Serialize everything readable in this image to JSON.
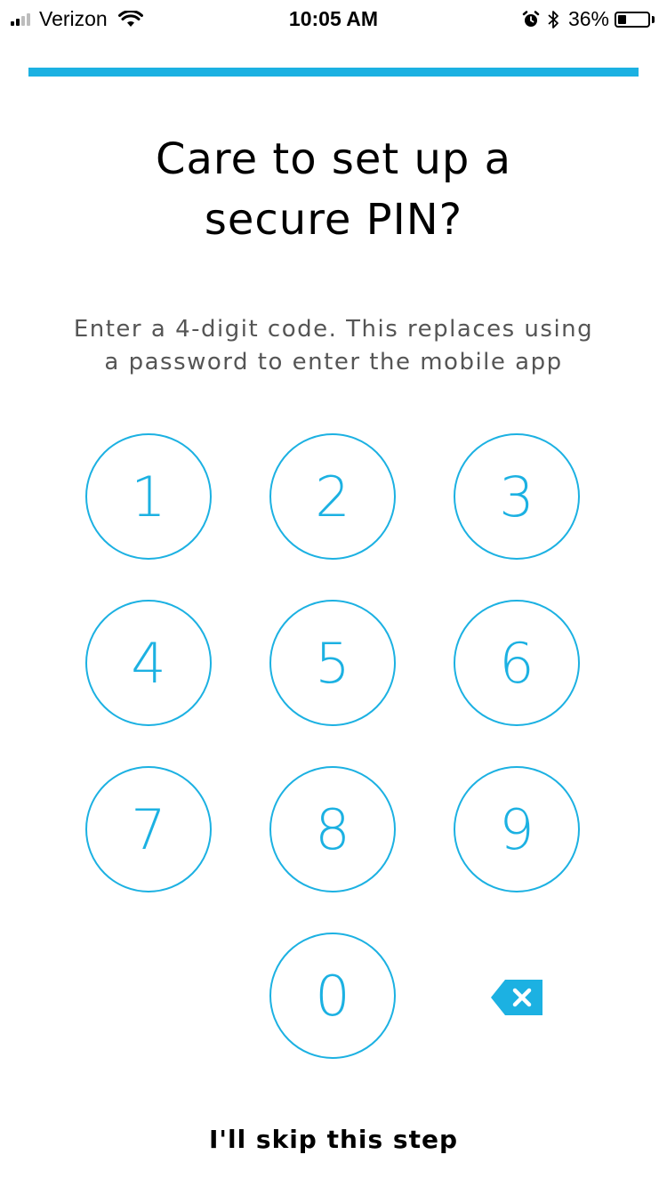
{
  "status_bar": {
    "carrier": "Verizon",
    "time": "10:05 AM",
    "battery_percent": "36%",
    "battery_level": 0.36,
    "icons": [
      "signal-icon",
      "wifi-icon",
      "alarm-icon",
      "bluetooth-icon",
      "battery-icon"
    ]
  },
  "progress": {
    "value": 1.0,
    "color": "#1cb1e2"
  },
  "title_line1": "Care to set up a",
  "title_line2": "secure PIN?",
  "subtitle_line1": "Enter a 4-digit code. This replaces using",
  "subtitle_line2": "a password to enter the mobile app",
  "keypad": {
    "k1": "1",
    "k2": "2",
    "k3": "3",
    "k4": "4",
    "k5": "5",
    "k6": "6",
    "k7": "7",
    "k8": "8",
    "k9": "9",
    "k0": "0",
    "delete_icon": "backspace-icon"
  },
  "skip_label": "I'll skip this step",
  "colors": {
    "accent": "#1cb1e2",
    "text": "#000000",
    "subtext": "#555555"
  }
}
